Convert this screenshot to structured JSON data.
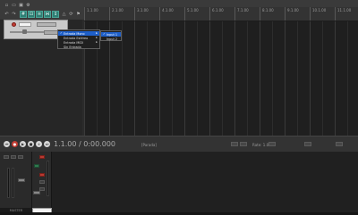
{
  "ruler": {
    "bars": [
      "1.1.00",
      "2.1.00",
      "3.1.00",
      "4.1.00",
      "5.1.00",
      "6.1.00",
      "7.1.00",
      "8.1.00",
      "9.1.00",
      "10.1.00",
      "11.1.00"
    ]
  },
  "input_menu": {
    "items": [
      {
        "label": "Entrada Mono",
        "checked": true,
        "has_submenu": true,
        "selected": true
      },
      {
        "label": "Entrada Estéreo",
        "checked": false,
        "has_submenu": true,
        "selected": false
      },
      {
        "label": "Entrada MIDI",
        "checked": false,
        "has_submenu": true,
        "selected": false
      },
      {
        "label": "Sin Entrada",
        "checked": false,
        "has_submenu": false,
        "selected": false
      }
    ]
  },
  "mono_submenu": {
    "items": [
      {
        "label": "Input 1",
        "checked": true,
        "selected": true
      },
      {
        "label": "Input 2",
        "checked": false,
        "selected": false
      }
    ]
  },
  "transport": {
    "time": "1.1.00 / 0:00.000",
    "status": "[Parada]",
    "rate": "Rate: 1.0"
  },
  "mixer": {
    "master_label": "MASTER"
  },
  "colors": {
    "selected": "#1e5fc9",
    "record": "#c23b32",
    "toolbar_active": "#2d7f74"
  }
}
